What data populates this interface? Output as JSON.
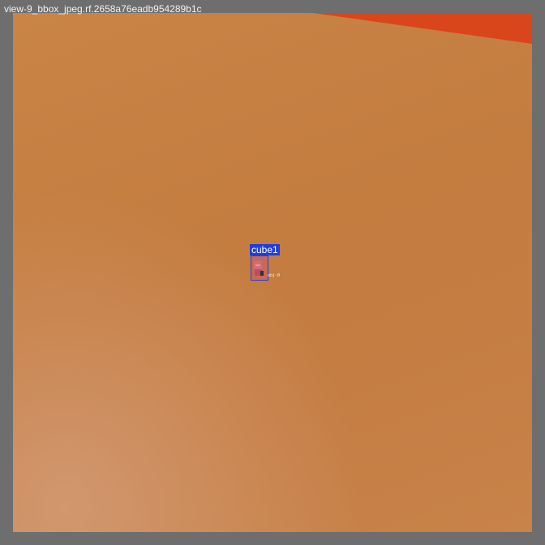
{
  "window": {
    "title": "view-9_bbox_jpeg.rf.2658a76eadb954289b1c"
  },
  "annotation": {
    "label": "cube1",
    "box_color": "#1f3fe0",
    "marker_text": "obj-0"
  },
  "colors": {
    "background": "#6e6e6e",
    "surface": "#c47c3f",
    "accent_wedge": "#d9461c"
  }
}
